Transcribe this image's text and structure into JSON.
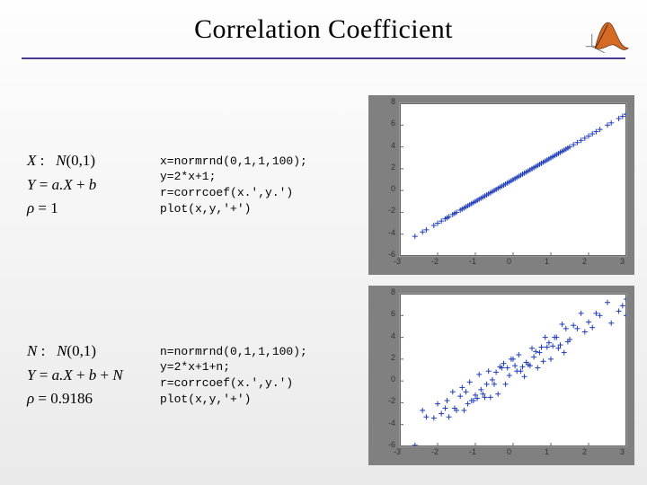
{
  "title": "Correlation Coefficient",
  "logo": "matlab-logo",
  "rows": [
    {
      "math": {
        "l1": "X :   N(0,1)",
        "l2": "Y = a·X + b",
        "l3": "ρ = 1"
      },
      "code": {
        "c1": "x=normrnd(0,1,1,100);",
        "c2": "y=2*x+1;",
        "c3": "r=corrcoef(x.',y.')",
        "c4": "plot(x,y,'+')"
      }
    },
    {
      "math": {
        "l1": "N :   N(0,1)",
        "l2": "Y = a·X + b + N",
        "l3": "ρ = 0.9186"
      },
      "code": {
        "c1": "n=normrnd(0,1,1,100);",
        "c2": "y=2*x+1+n;",
        "c3": "r=corrcoef(x.',y.')",
        "c4": "plot(x,y,'+')"
      }
    }
  ],
  "chart_data": [
    {
      "type": "scatter",
      "title": "",
      "xlabel": "",
      "ylabel": "",
      "xlim": [
        -3,
        3
      ],
      "ylim": [
        -6,
        8
      ],
      "xticks": [
        -3,
        -2,
        -1,
        0,
        1,
        2,
        3
      ],
      "yticks": [
        -6,
        -4,
        -2,
        0,
        2,
        4,
        6,
        8
      ],
      "marker": "+",
      "color": "#1f3db8",
      "series": [
        {
          "name": "y=2x+1",
          "x": [
            -2.6,
            -2.4,
            -2.3,
            -2.1,
            -2.0,
            -1.9,
            -1.8,
            -1.75,
            -1.7,
            -1.6,
            -1.55,
            -1.5,
            -1.4,
            -1.35,
            -1.3,
            -1.25,
            -1.2,
            -1.15,
            -1.1,
            -1.05,
            -1.0,
            -0.95,
            -0.9,
            -0.85,
            -0.8,
            -0.75,
            -0.7,
            -0.65,
            -0.6,
            -0.55,
            -0.5,
            -0.45,
            -0.4,
            -0.35,
            -0.3,
            -0.25,
            -0.2,
            -0.15,
            -0.1,
            -0.05,
            0.0,
            0.05,
            0.1,
            0.15,
            0.2,
            0.25,
            0.3,
            0.35,
            0.4,
            0.45,
            0.5,
            0.55,
            0.6,
            0.65,
            0.7,
            0.75,
            0.8,
            0.85,
            0.9,
            0.95,
            1.0,
            1.05,
            1.1,
            1.15,
            1.2,
            1.25,
            1.3,
            1.35,
            1.4,
            1.45,
            1.5,
            1.6,
            1.7,
            1.8,
            1.9,
            2.0,
            2.1,
            2.2,
            2.3,
            2.5,
            2.6,
            2.8,
            2.9,
            3.0,
            3.0
          ],
          "y": [
            -4.2,
            -3.8,
            -3.6,
            -3.2,
            -3.0,
            -2.8,
            -2.6,
            -2.5,
            -2.4,
            -2.2,
            -2.1,
            -2.0,
            -1.8,
            -1.7,
            -1.6,
            -1.5,
            -1.4,
            -1.3,
            -1.2,
            -1.1,
            -1.0,
            -0.9,
            -0.8,
            -0.7,
            -0.6,
            -0.5,
            -0.4,
            -0.3,
            -0.2,
            -0.1,
            0.0,
            0.1,
            0.2,
            0.3,
            0.4,
            0.5,
            0.6,
            0.7,
            0.8,
            0.9,
            1.0,
            1.1,
            1.2,
            1.3,
            1.4,
            1.5,
            1.6,
            1.7,
            1.8,
            1.9,
            2.0,
            2.1,
            2.2,
            2.3,
            2.4,
            2.5,
            2.6,
            2.7,
            2.8,
            2.9,
            3.0,
            3.1,
            3.2,
            3.3,
            3.4,
            3.5,
            3.6,
            3.7,
            3.8,
            3.9,
            4.0,
            4.2,
            4.4,
            4.6,
            4.8,
            5.0,
            5.2,
            5.4,
            5.6,
            6.0,
            6.2,
            6.6,
            6.8,
            7.0,
            7.0
          ]
        }
      ]
    },
    {
      "type": "scatter",
      "title": "",
      "xlabel": "",
      "ylabel": "",
      "xlim": [
        -3,
        3
      ],
      "ylim": [
        -6,
        8
      ],
      "xticks": [
        -3,
        -2,
        -1,
        0,
        1,
        2,
        3
      ],
      "yticks": [
        -6,
        -4,
        -2,
        0,
        2,
        4,
        6,
        8
      ],
      "marker": "+",
      "color": "#1f3db8",
      "series": [
        {
          "name": "y=2x+1+n",
          "x": [
            -2.6,
            -2.4,
            -2.3,
            -2.1,
            -2.0,
            -1.9,
            -1.8,
            -1.75,
            -1.7,
            -1.6,
            -1.55,
            -1.5,
            -1.4,
            -1.35,
            -1.3,
            -1.25,
            -1.2,
            -1.15,
            -1.1,
            -1.05,
            -1.0,
            -0.95,
            -0.9,
            -0.85,
            -0.8,
            -0.75,
            -0.7,
            -0.65,
            -0.6,
            -0.55,
            -0.5,
            -0.45,
            -0.4,
            -0.35,
            -0.3,
            -0.25,
            -0.2,
            -0.15,
            -0.1,
            -0.05,
            0.0,
            0.05,
            0.1,
            0.15,
            0.2,
            0.25,
            0.3,
            0.35,
            0.4,
            0.45,
            0.5,
            0.55,
            0.6,
            0.65,
            0.7,
            0.75,
            0.8,
            0.85,
            0.9,
            0.95,
            1.0,
            1.05,
            1.1,
            1.15,
            1.2,
            1.25,
            1.3,
            1.35,
            1.4,
            1.45,
            1.5,
            1.6,
            1.7,
            1.8,
            1.9,
            2.0,
            2.1,
            2.2,
            2.3,
            2.5,
            2.6,
            2.8,
            2.9,
            3.0,
            3.0
          ],
          "y": [
            -5.9,
            -2.7,
            -3.3,
            -3.4,
            -2.1,
            -3.0,
            -2.5,
            -1.8,
            -3.3,
            -1.0,
            -2.5,
            -2.7,
            -1.4,
            -0.6,
            -2.7,
            -1.0,
            -2.1,
            -0.1,
            -1.8,
            -1.8,
            -1.3,
            -1.6,
            0.6,
            -0.8,
            -1.2,
            -1.5,
            -0.3,
            0.9,
            -1.5,
            0.1,
            -0.3,
            0.8,
            -1.2,
            1.3,
            1.2,
            1.6,
            -0.3,
            1.2,
            0.5,
            2.0,
            2.0,
            1.4,
            0.9,
            2.4,
            0.9,
            1.3,
            0.4,
            1.7,
            1.5,
            1.4,
            3.0,
            2.2,
            2.7,
            1.2,
            2.6,
            3.1,
            1.8,
            4.0,
            3.1,
            3.5,
            2.0,
            3.2,
            4.0,
            4.0,
            3.0,
            3.3,
            5.2,
            2.6,
            4.8,
            3.6,
            3.8,
            5.1,
            4.8,
            6.2,
            4.5,
            5.4,
            4.9,
            6.2,
            6.0,
            7.2,
            5.3,
            6.4,
            6.9,
            6.0,
            7.5
          ]
        }
      ]
    }
  ]
}
